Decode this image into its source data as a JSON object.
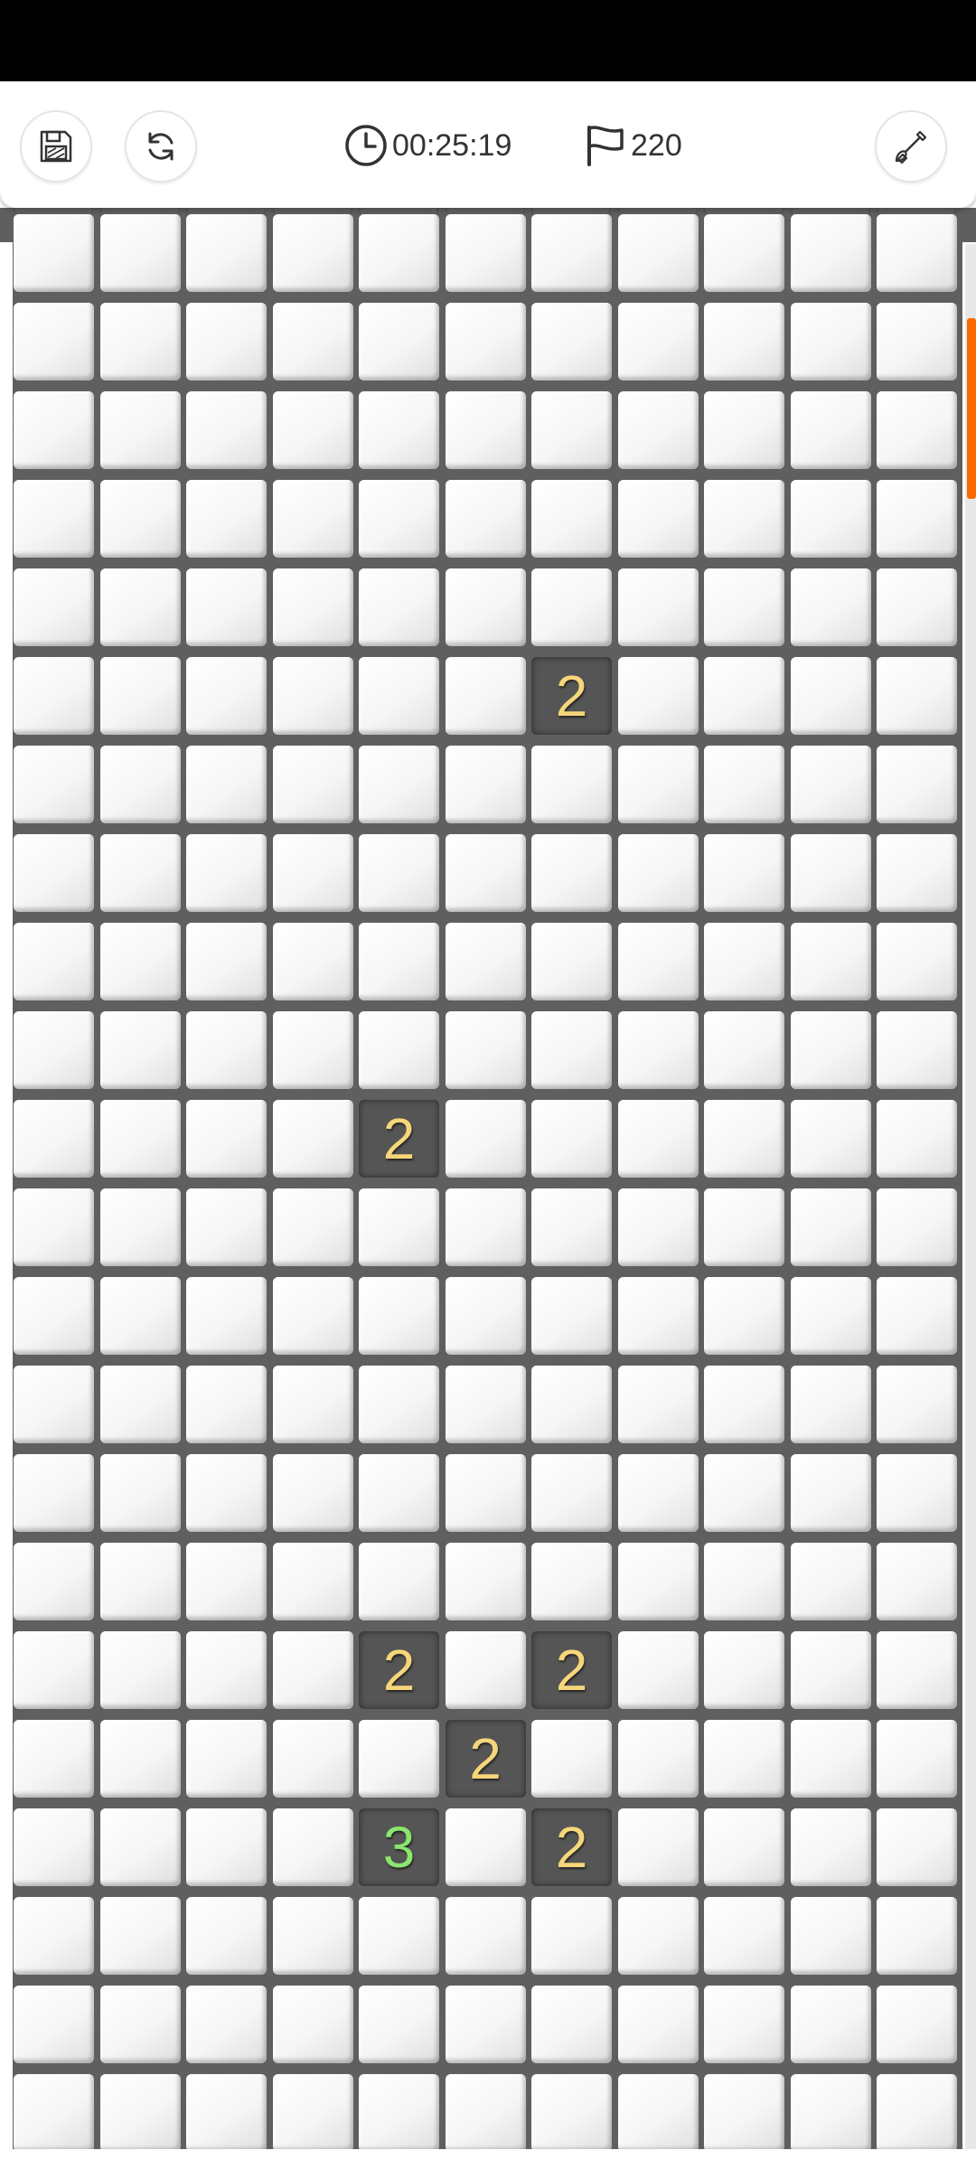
{
  "hud": {
    "timer": "00:25:19",
    "flags": "220"
  },
  "icons": {
    "save": "save-icon",
    "restart": "restart-icon",
    "clock": "clock-icon",
    "flag": "flag-icon",
    "shovel": "shovel-icon"
  },
  "colors": {
    "accent": "#ff6a00",
    "number_2": "#f5d67a",
    "number_3": "#8ae66e",
    "revealed_cell": "#555555"
  },
  "board": {
    "columns": 11,
    "visible_rows": 22,
    "revealed": [
      {
        "row": 5,
        "col": 6,
        "value": "2"
      },
      {
        "row": 10,
        "col": 4,
        "value": "2"
      },
      {
        "row": 16,
        "col": 4,
        "value": "2"
      },
      {
        "row": 16,
        "col": 6,
        "value": "2"
      },
      {
        "row": 17,
        "col": 5,
        "value": "2"
      },
      {
        "row": 18,
        "col": 4,
        "value": "3"
      },
      {
        "row": 18,
        "col": 6,
        "value": "2"
      }
    ]
  }
}
